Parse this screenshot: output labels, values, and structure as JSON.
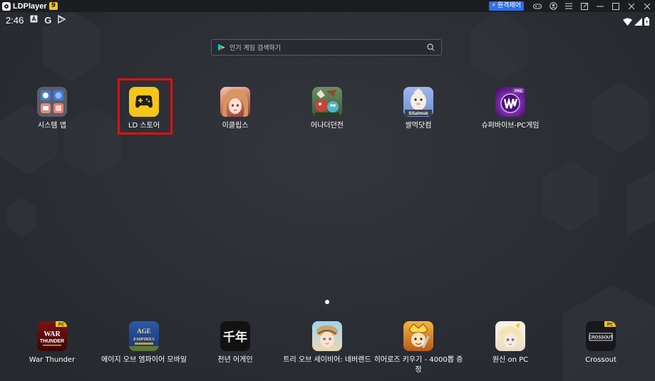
{
  "titlebar": {
    "app_name": "LDPlayer",
    "version": "9",
    "remote_control_label": "원격제어"
  },
  "statusbar": {
    "time": "2:46",
    "icons": [
      "a-icon",
      "google-icon",
      "play-store-icon"
    ]
  },
  "search": {
    "placeholder": "인기 게임 검색하기"
  },
  "home_apps": [
    {
      "label": "시스템 앱",
      "icon": "system-apps-folder-icon"
    },
    {
      "label": "LD 스토어",
      "icon": "ld-store-icon",
      "highlighted": true
    },
    {
      "label": "이클립스",
      "icon": "eclipse-game-icon"
    },
    {
      "label": "어나더던전",
      "icon": "another-dungeon-icon"
    },
    {
      "label": "쌀먹닷컴",
      "icon": "ssalmeok-icon"
    },
    {
      "label": "슈퍼바이브-PC게임",
      "icon": "supervive-icon"
    }
  ],
  "dock_apps": [
    {
      "label": "War Thunder",
      "icon": "war-thunder-icon"
    },
    {
      "label": "에이지 오브 엠파이어 모바일",
      "icon": "age-of-empires-icon"
    },
    {
      "label": "천년 어게인",
      "icon": "cheonnyeon-icon"
    },
    {
      "label": "트리 오브 세이비어: 네버랜드",
      "icon": "tree-of-savior-icon"
    },
    {
      "label": "히어로즈 키우기 - 4000뽑 증정",
      "icon": "heroes-icon"
    },
    {
      "label": "원신 on PC",
      "icon": "genshin-icon"
    },
    {
      "label": "Crossout",
      "icon": "crossout-icon"
    }
  ],
  "icon_text": {
    "ssalmeok": "SSalmuk",
    "supervive_badge": "PRE",
    "pc_badge": "PC",
    "war": "WAR",
    "thunder": "THUNDER",
    "age1": "AGE",
    "age2": "EMPIRES",
    "cheon": "千年",
    "crossout": "CROSSOUT"
  },
  "colors": {
    "highlight": "#e01010",
    "ld_store": "#f5c518",
    "remote_btn": "#2f6fea"
  }
}
